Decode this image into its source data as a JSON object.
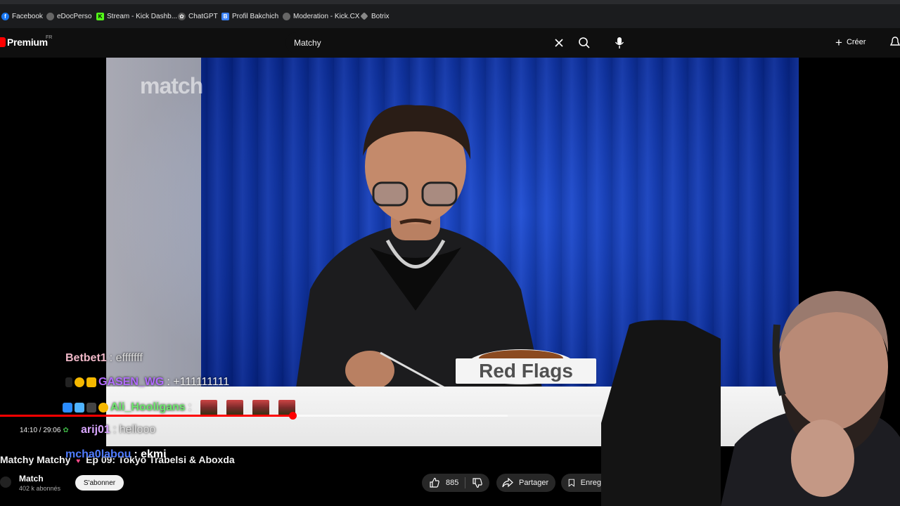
{
  "bookmarks": [
    {
      "label": "Facebook",
      "icon": "facebook-icon",
      "color": "#1877f2"
    },
    {
      "label": "eDocPerso",
      "icon": "globe-icon",
      "color": "#888888"
    },
    {
      "label": "Stream - Kick Dashb...",
      "icon": "kick-icon",
      "color": "#53fc18"
    },
    {
      "label": "ChatGPT",
      "icon": "chatgpt-icon",
      "color": "#aaaaaa"
    },
    {
      "label": "Profil Bakchich",
      "icon": "bookmark-icon",
      "color": "#3b82f6"
    },
    {
      "label": "Moderation - Kick.CX",
      "icon": "globe-icon",
      "color": "#888888"
    },
    {
      "label": "Botrix",
      "icon": "botrix-icon",
      "color": "#cccccc"
    }
  ],
  "header": {
    "logo_text": "Premium",
    "logo_country": "FR",
    "search_value": "Matchy",
    "create_label": "Créer"
  },
  "player": {
    "watermark": "match",
    "overlay_card": "Red Flags",
    "current_time": "14:10",
    "duration": "29:06",
    "time_sep": " / ",
    "progress_fraction": 0.487,
    "buffered_fraction": 0.845
  },
  "chat": [
    {
      "user": "Betbet1",
      "message": ": efffffff",
      "user_color": "#f0b8c8"
    },
    {
      "user": "GASEN_WG",
      "message": ": +111111111",
      "user_color": "#b26bff"
    },
    {
      "user": "Ali_Hooligans",
      "message": ":",
      "user_color": "#6ee76e"
    },
    {
      "user": "arij01",
      "message": ": hellooo",
      "user_color": "#d9a6ff"
    },
    {
      "user": "mcha0labou",
      "message": ": ekmi",
      "user_color": "#4f7bff"
    }
  ],
  "video": {
    "title_part1": "Matchy Matchy",
    "title_part2": "Ep 09: Tokyo Trabelsi & Aboxda",
    "channel": "Match",
    "subscribers": "402 k abonnés",
    "subscribe_label": "S'abonner",
    "likes": "885",
    "share_label": "Partager",
    "save_label": "Enreg"
  },
  "colors": {
    "accent": "#ff0000",
    "background": "#0f0f0f"
  }
}
